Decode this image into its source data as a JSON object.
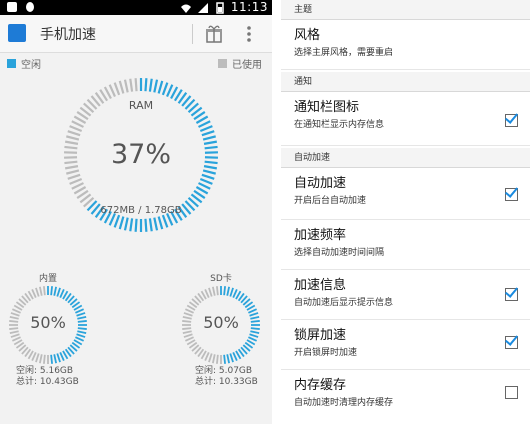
{
  "statusbar": {
    "time": "11:13"
  },
  "appbar": {
    "title": "手机加速"
  },
  "legend": {
    "free_label": "空闲",
    "used_label": "已使用",
    "free_color": "#2aa3db",
    "used_color": "#bcbcbc"
  },
  "ram": {
    "title": "RAM",
    "percent_label": "37%",
    "percent_value": 0.37,
    "usage": "672MB / 1.78GB"
  },
  "internal": {
    "title": "内置",
    "percent_label": "50%",
    "percent_value": 0.5,
    "free": "空闲: 5.16GB",
    "total": "总计: 10.43GB"
  },
  "sdcard": {
    "title": "SD卡",
    "percent_label": "50%",
    "percent_value": 0.5,
    "free": "空闲: 5.07GB",
    "total": "总计: 10.33GB"
  },
  "settings": {
    "section_theme": "主题",
    "theme": {
      "title": "风格",
      "subtitle": "选择主屏风格，需要重启"
    },
    "section_notify": "通知",
    "notify_icon": {
      "title": "通知栏图标",
      "subtitle": "在通知栏显示内存信息",
      "checked": true
    },
    "section_auto": "自动加速",
    "auto_speed": {
      "title": "自动加速",
      "subtitle": "开启后台自动加速",
      "checked": true
    },
    "speed_freq": {
      "title": "加速频率",
      "subtitle": "选择自动加速时间间隔"
    },
    "speed_info": {
      "title": "加速信息",
      "subtitle": "自动加速后显示提示信息",
      "checked": true
    },
    "lock_speed": {
      "title": "锁屏加速",
      "subtitle": "开启锁屏时加速",
      "checked": true
    },
    "mem_cache": {
      "title": "内存缓存",
      "subtitle": "自动加速时清理内存缓存",
      "checked": false
    }
  }
}
